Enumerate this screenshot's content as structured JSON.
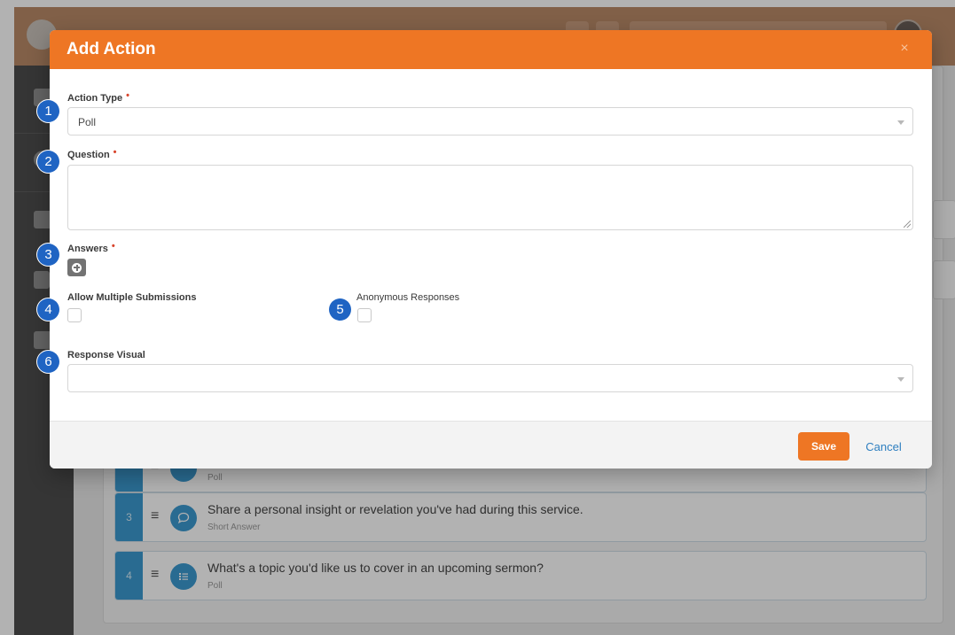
{
  "modal": {
    "title": "Add Action",
    "close_symbol": "×",
    "fields": {
      "action_type": {
        "label": "Action Type",
        "required_mark": "•",
        "value": "Poll"
      },
      "question": {
        "label": "Question",
        "required_mark": "•",
        "value": ""
      },
      "answers": {
        "label": "Answers",
        "required_mark": "•"
      },
      "allow_multiple_submissions": {
        "label": "Allow Multiple Submissions",
        "checked": false
      },
      "anonymous_responses": {
        "label": "Anonymous Responses",
        "checked": false
      },
      "response_visual": {
        "label": "Response Visual",
        "value": ""
      }
    },
    "footer": {
      "save_label": "Save",
      "cancel_label": "Cancel"
    }
  },
  "callouts": [
    "1",
    "2",
    "3",
    "4",
    "5",
    "6"
  ],
  "background_list": {
    "items": [
      {
        "number": "",
        "title": "",
        "subtitle": "Poll",
        "icon": "poll-icon"
      },
      {
        "number": "3",
        "title": "Share a personal insight or revelation you've had during this service.",
        "subtitle": "Short Answer",
        "icon": "chat-bubble-icon"
      },
      {
        "number": "4",
        "title": "What's a topic you'd like us to cover in an upcoming sermon?",
        "subtitle": "Poll",
        "icon": "list-icon"
      }
    ]
  },
  "colors": {
    "accent": "#ee7624",
    "callout": "#1f64c3",
    "item_accent": "#3b9ad0",
    "link": "#2e7fc0",
    "required": "#d8442c"
  }
}
